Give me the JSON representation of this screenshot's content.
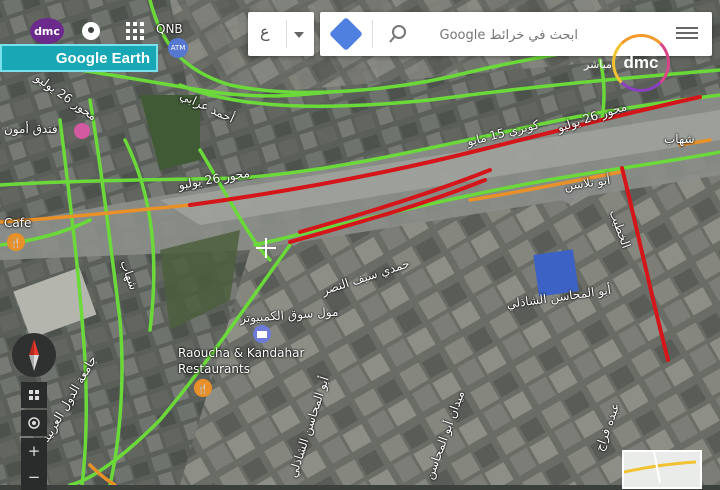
{
  "header": {
    "channel_logo": "dmc",
    "badge": "Google Earth",
    "atm_label": "QNB",
    "atm_badge": "ATM"
  },
  "search": {
    "placeholder": "ابحث في خرائط Google",
    "lang_label": "ع"
  },
  "watermark": {
    "logo": "dmc",
    "live": "مباشر"
  },
  "places": [
    {
      "name": "Cafe"
    },
    {
      "name": "مول سوق الكمبيوتر"
    },
    {
      "name": "Raoucha & Kandahar"
    },
    {
      "name": "Restaurants"
    },
    {
      "name": "فندق أمون"
    }
  ],
  "streets": [
    {
      "name": "أحمد عرابي"
    },
    {
      "name": "كوبري 15 مايو"
    },
    {
      "name": "محور 26 يوليو"
    },
    {
      "name": "محور 26 يوليو"
    },
    {
      "name": "محور 26 يوليو"
    },
    {
      "name": "أبو المحاسن الشاذلي"
    },
    {
      "name": "أبو المحاسن الشاذلي"
    },
    {
      "name": "جامعة الدول العربية"
    },
    {
      "name": "ميدان أبو المحاسن"
    },
    {
      "name": "عبده فراج"
    },
    {
      "name": "شهاب"
    },
    {
      "name": "أبو تلاسن"
    },
    {
      "name": "الخطيب"
    },
    {
      "name": "حمدي سيف النصر"
    },
    {
      "name": "شهاب"
    }
  ],
  "traffic_colors": {
    "free": "#6bd93a",
    "slow": "#e8902a",
    "heavy": "#d4161a"
  },
  "controls": {
    "zoom_in": "+",
    "zoom_out": "−"
  }
}
